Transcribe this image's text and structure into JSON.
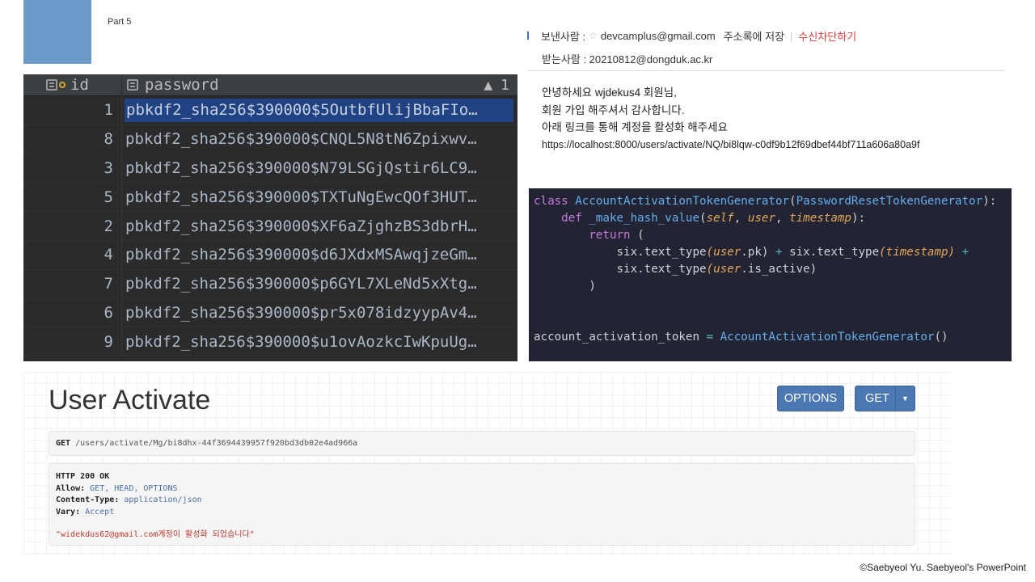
{
  "slide": {
    "part_label": "Part 5",
    "accent_color": "#6b9bc8",
    "footer": "©Saebyeol Yu. Saebyeol's PowerPoint"
  },
  "db": {
    "col_id": "id",
    "col_password": "password",
    "sort_indicator": "1",
    "rows": [
      {
        "id": "1",
        "password": "pbkdf2_sha256$390000$5OutbfUlijBbaFIo…",
        "selected": true
      },
      {
        "id": "8",
        "password": "pbkdf2_sha256$390000$CNQL5N8tN6Zpixwv…"
      },
      {
        "id": "3",
        "password": "pbkdf2_sha256$390000$N79LSGjQstir6LC9…"
      },
      {
        "id": "5",
        "password": "pbkdf2_sha256$390000$TXTuNgEwcQOf3HUT…"
      },
      {
        "id": "2",
        "password": "pbkdf2_sha256$390000$XF6aZjghzBS3dbrH…"
      },
      {
        "id": "4",
        "password": "pbkdf2_sha256$390000$d6JXdxMSAwqjzeGm…"
      },
      {
        "id": "7",
        "password": "pbkdf2_sha256$390000$p6GYL7XLeNd5xXtg…"
      },
      {
        "id": "6",
        "password": "pbkdf2_sha256$390000$pr5x078idzyypAv4…"
      },
      {
        "id": "9",
        "password": "pbkdf2_sha256$390000$u1ovAozkcIwKpuUg…"
      }
    ]
  },
  "mail": {
    "from_label": "보낸사람 :",
    "from_addr": "devcamplus@gmail.com",
    "save_contact": "주소록에 저장",
    "block": "수신차단하기",
    "to": "받는사람 : 20210812@dongduk.ac.kr",
    "body": [
      "안녕하세요 wjdekus4 회원님,",
      "회원 가입 해주셔서 감사합니다.",
      "아래 링크를 통해 계정을 활성화 해주세요",
      "https://localhost:8000/users/activate/NQ/bi8lqw-c0df9b12f69dbef44bf711a606a80a9f"
    ]
  },
  "code": {
    "l1_kw": "class ",
    "l1_cls": "AccountActivationTokenGenerator",
    "l1_p1": "(",
    "l1_base": "PasswordResetTokenGenerator",
    "l1_p2": "):",
    "l2_kw": "def ",
    "l2_fn": "_make_hash_value",
    "l2_p1": "(",
    "l2_a1": "self",
    "l2_c1": ", ",
    "l2_a2": "user",
    "l2_c2": ", ",
    "l2_a3": "timestamp",
    "l2_p2": "):",
    "l3_kw": "return",
    "l3_rest": " (",
    "l4_a": "six.text_type",
    "l4_b": "(",
    "l4_c": "user",
    "l4_d": ".pk) ",
    "l4_op1": "+",
    "l4_e": " six.text_type",
    "l4_f": "(",
    "l4_g": "timestamp",
    "l4_h": ") ",
    "l4_op2": "+",
    "l5_a": "six.text_type",
    "l5_b": "(",
    "l5_c": "user",
    "l5_d": ".is_active)",
    "l6": ")",
    "l8_a": "account_activation_token ",
    "l8_op": "=",
    "l8_cls": " AccountActivationTokenGenerator",
    "l8_end": "()"
  },
  "api": {
    "title": "User Activate",
    "options_label": "OPTIONS",
    "get_label": "GET",
    "request_method": "GET",
    "request_url": "/users/activate/Mg/bi8dhx-44f3694439957f920bd3db02e4ad966a",
    "status": "HTTP 200 OK",
    "headers": [
      {
        "k": "Allow:",
        "v": "GET, HEAD, OPTIONS"
      },
      {
        "k": "Content-Type:",
        "v": "application/json"
      },
      {
        "k": "Vary:",
        "v": "Accept"
      }
    ],
    "response_body": "\"widekdus62@gmail.com계정이 활성화 되었습니다\""
  }
}
